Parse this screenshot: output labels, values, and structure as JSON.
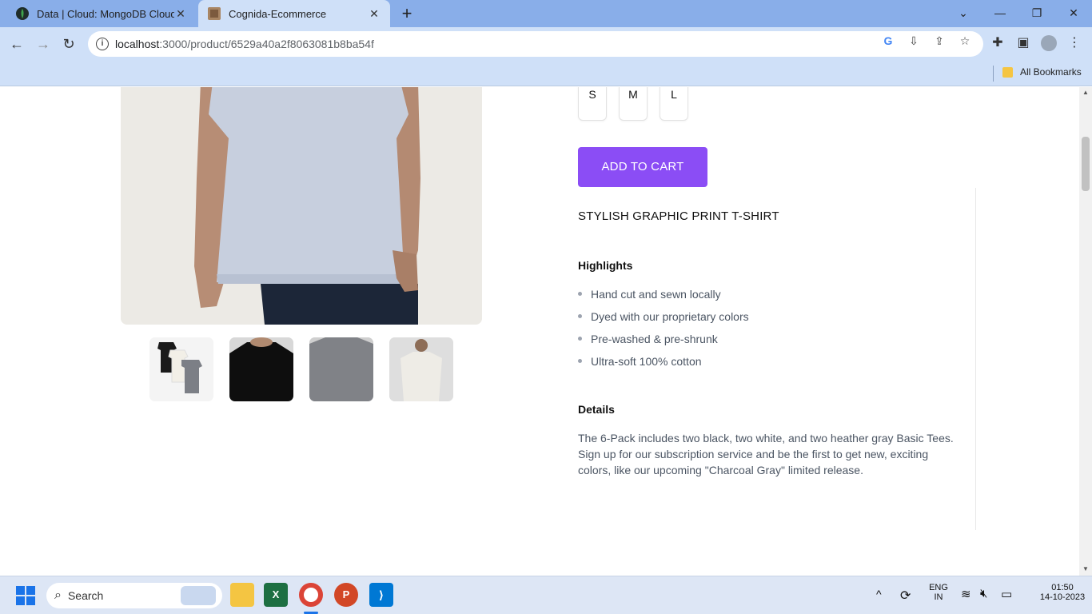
{
  "browser": {
    "tabs": [
      {
        "title": "Data | Cloud: MongoDB Cloud",
        "active": false
      },
      {
        "title": "Cognida-Ecommerce",
        "active": true
      }
    ],
    "url_host": "localhost",
    "url_path": ":3000/product/6529a40a2f8063081b8ba54f",
    "bookmarks_label": "All Bookmarks"
  },
  "product": {
    "sizes": [
      "S",
      "M",
      "L"
    ],
    "add_to_cart_label": "ADD TO CART",
    "title": "STYLISH GRAPHIC PRINT T-SHIRT",
    "highlights_heading": "Highlights",
    "highlights": [
      "Hand cut and sewn locally",
      "Dyed with our proprietary colors",
      "Pre-washed & pre-shrunk",
      "Ultra-soft 100% cotton"
    ],
    "details_heading": "Details",
    "details_text": "The 6-Pack includes two black, two white, and two heather gray Basic Tees. Sign up for our subscription service and be the first to get new, exciting colors, like our upcoming \"Charcoal Gray\" limited release."
  },
  "taskbar": {
    "search_label": "Search",
    "lang_top": "ENG",
    "lang_bottom": "IN",
    "time": "01:50",
    "date": "14-10-2023"
  },
  "colors": {
    "accent": "#8b4df5",
    "tabstrip": "#89aee9",
    "toolbar": "#cfe0f8"
  }
}
